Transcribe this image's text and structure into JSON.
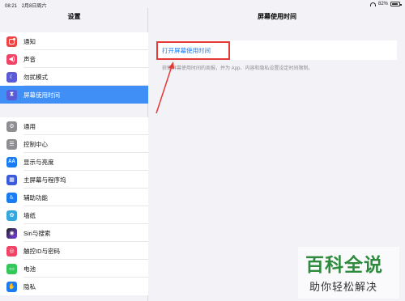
{
  "status": {
    "time": "08:21",
    "date": "2月8日周六",
    "battery": "82%",
    "battery_level": 0.82
  },
  "sidebar": {
    "title": "设置",
    "group1": [
      {
        "label": "通知",
        "icon": "notification-icon",
        "color": "#ef4444"
      },
      {
        "label": "声音",
        "icon": "speaker-icon",
        "color": "#ef4466"
      },
      {
        "label": "勿扰模式",
        "icon": "moon-icon",
        "color": "#5b5bd6"
      },
      {
        "label": "屏幕使用时间",
        "icon": "hourglass-icon",
        "color": "#5b5bd6",
        "selected": true
      }
    ],
    "group2": [
      {
        "label": "通用",
        "icon": "gear-icon",
        "color": "#8e8e93"
      },
      {
        "label": "控制中心",
        "icon": "control-center-icon",
        "color": "#8e8e93"
      },
      {
        "label": "显示与亮度",
        "icon": "display-icon",
        "color": "#1a7cf5"
      },
      {
        "label": "主屏幕与程序坞",
        "icon": "home-screen-icon",
        "color": "#3b5bdb"
      },
      {
        "label": "辅助功能",
        "icon": "accessibility-icon",
        "color": "#1a7cf5"
      },
      {
        "label": "墙纸",
        "icon": "wallpaper-icon",
        "color": "#35a7e0"
      },
      {
        "label": "Siri与搜索",
        "icon": "siri-icon",
        "color": "#222222"
      },
      {
        "label": "触控ID与密码",
        "icon": "fingerprint-icon",
        "color": "#ef4466"
      },
      {
        "label": "电池",
        "icon": "battery-icon",
        "color": "#34c759"
      },
      {
        "label": "隐私",
        "icon": "hand-icon",
        "color": "#1a7cf5"
      }
    ]
  },
  "main": {
    "title": "屏幕使用时间",
    "link": "打开屏幕使用时间",
    "description": "获取屏幕使用时间的周报，并为 App、内容和隐私设置设定时间限制。"
  },
  "watermark": {
    "main": "百科全说",
    "sub": "助你轻松解决"
  }
}
